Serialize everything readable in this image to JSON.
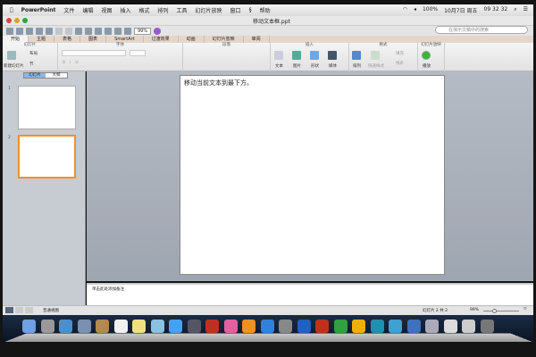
{
  "menubar": {
    "app": "PowerPoint",
    "items": [
      "文件",
      "编辑",
      "视图",
      "插入",
      "格式",
      "排列",
      "工具",
      "幻灯片放映",
      "窗口",
      "帮助"
    ],
    "battery": "100%",
    "date": "10月7日 周五",
    "time": "09 32 32"
  },
  "window": {
    "title": "移动文本框.ppt"
  },
  "toolbar": {
    "zoom": "99%",
    "search_placeholder": "在演示文稿中的搜索"
  },
  "tabs": [
    "开始",
    "主题",
    "表格",
    "图表",
    "SmartArt",
    "过渡效果",
    "动画",
    "幻灯片放映",
    "审阅"
  ],
  "ribbon": {
    "groups": {
      "slides": "幻灯片",
      "font": "字体",
      "paragraph": "段落",
      "insert": "插入",
      "format": "格式",
      "slideshow": "幻灯片放映"
    },
    "new_slide": "新建幻灯片",
    "layout": "布局",
    "section": "节",
    "text": "文本",
    "picture": "图片",
    "shape": "形状",
    "media": "媒体",
    "arrange": "排列",
    "quick_styles": "快速样式",
    "fill": "填充",
    "line": "线条",
    "play": "播放"
  },
  "sidepanel": {
    "tab_slides": "幻灯片",
    "tab_outline": "大纲",
    "slides": [
      "1",
      "2"
    ]
  },
  "slide": {
    "text": "移动当前文本到最下方。"
  },
  "notes": {
    "placeholder": "单击此处添加备注"
  },
  "status": {
    "view": "普通视图",
    "slide_count": "幻灯片 2 共 2",
    "zoom": "99%",
    "zoom_level": 0.3
  },
  "dock": {
    "colors": [
      "#6fa0e0",
      "#999",
      "#4a90d0",
      "#7a90b0",
      "#b08a50",
      "#f0f0f0",
      "#f0e080",
      "#8ac0e0",
      "#4aa0f0",
      "#556",
      "#c03020",
      "#e060a0",
      "#f09020",
      "#3080e0",
      "#888",
      "#2060c0",
      "#c03020",
      "#30a040",
      "#f0b000",
      "#2090b0",
      "#40a0d0",
      "#4070c0",
      "#aab",
      "#ddd",
      "#ccc",
      "#777"
    ]
  }
}
